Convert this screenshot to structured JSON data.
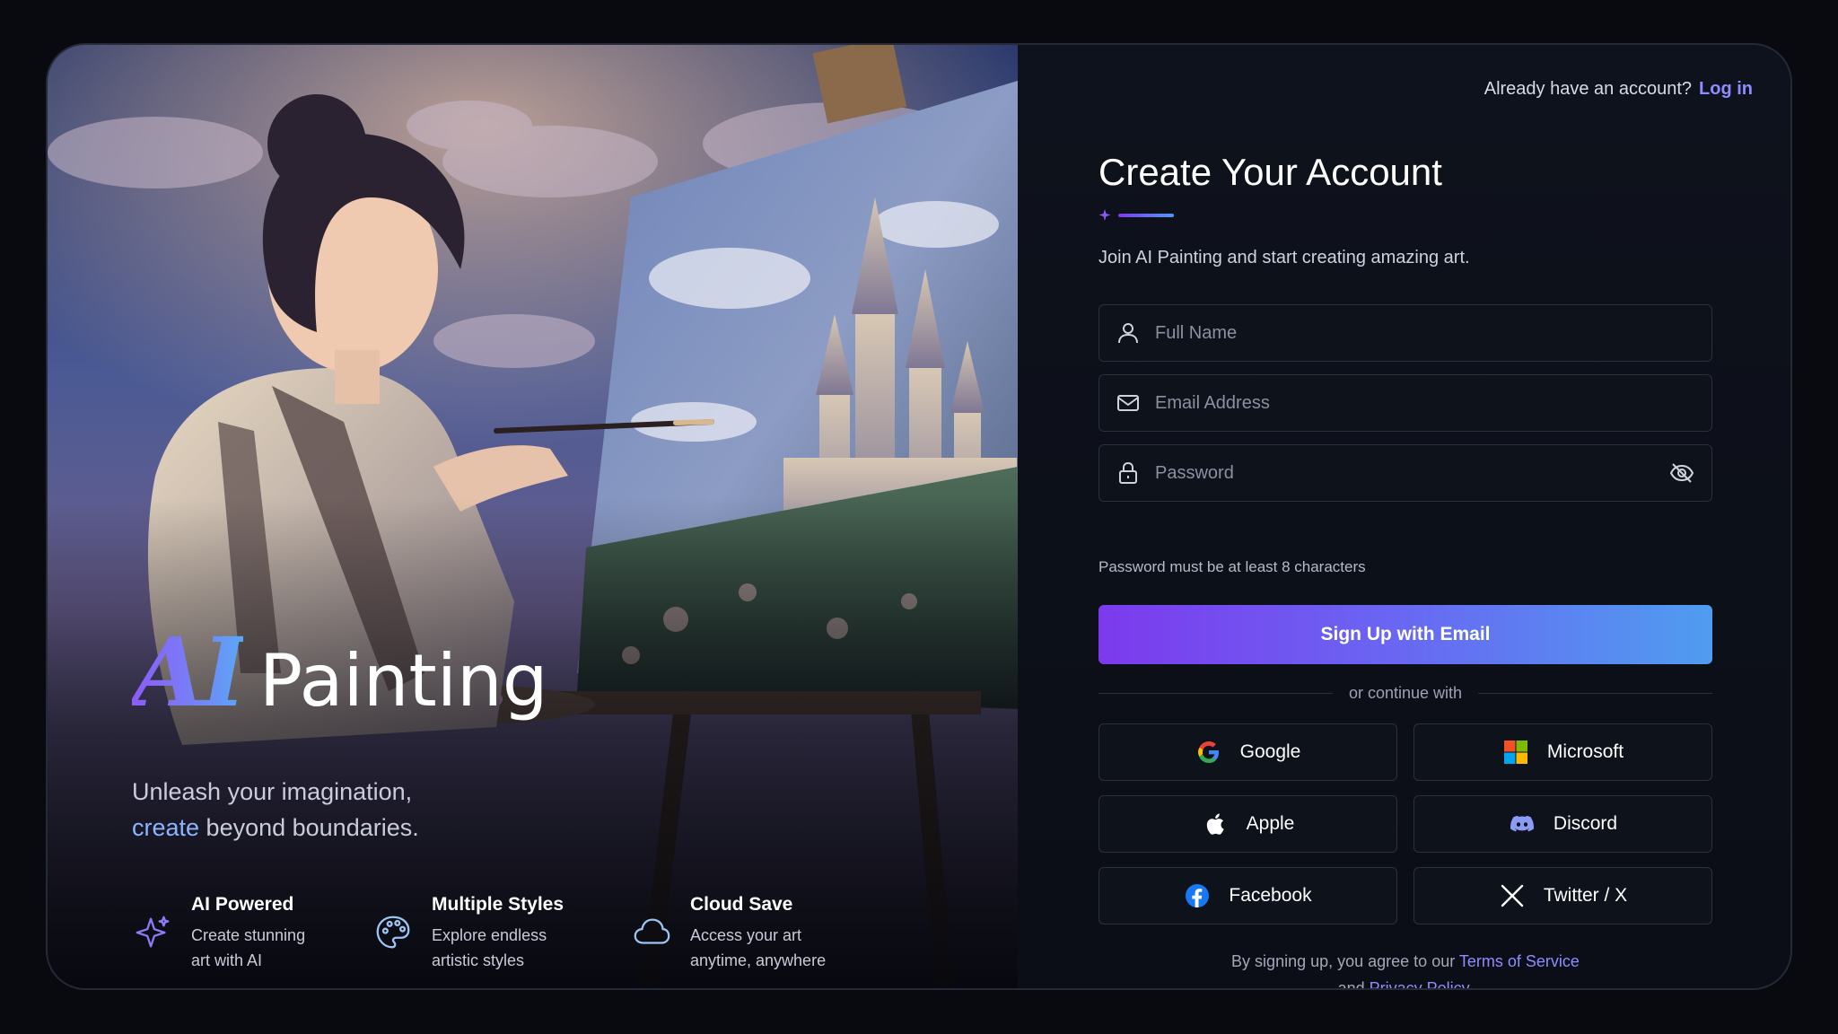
{
  "hero": {
    "brand_ai": "AI",
    "brand_word": "Painting",
    "tagline_line1": "Unleash your imagination,",
    "tagline_accent": "create",
    "tagline_rest": " beyond boundaries.",
    "features": [
      {
        "icon": "sparkle-icon",
        "title": "AI Powered",
        "line1": "Create stunning",
        "line2": "art with AI"
      },
      {
        "icon": "palette-icon",
        "title": "Multiple Styles",
        "line1": "Explore endless",
        "line2": "artistic styles"
      },
      {
        "icon": "cloud-icon",
        "title": "Cloud Save",
        "line1": "Access your art",
        "line2": "anytime, anywhere"
      }
    ]
  },
  "header": {
    "prompt": "Already have an account?",
    "login_label": "Log in"
  },
  "form": {
    "title": "Create Your Account",
    "subtitle": "Join AI Painting and start creating amazing art.",
    "full_name_placeholder": "Full Name",
    "email_placeholder": "Email Address",
    "password_placeholder": "Password",
    "password_hint": "Password must be at least 8 characters",
    "submit_label": "Sign Up with Email",
    "divider_label": "or continue with"
  },
  "social": [
    {
      "icon": "google-icon",
      "label": "Google"
    },
    {
      "icon": "microsoft-icon",
      "label": "Microsoft"
    },
    {
      "icon": "apple-icon",
      "label": "Apple"
    },
    {
      "icon": "discord-icon",
      "label": "Discord"
    },
    {
      "icon": "facebook-icon",
      "label": "Facebook"
    },
    {
      "icon": "x-icon",
      "label": "Twitter / X"
    }
  ],
  "legal": {
    "prefix": "By signing up, you agree to our ",
    "terms_label": "Terms of Service",
    "middle": "and ",
    "privacy_label": "Privacy Policy",
    "suffix": "."
  },
  "colors": {
    "accent": "#8f8cff",
    "gradient_start": "#7c3aed",
    "gradient_end": "#4f9df0",
    "panel_bg": "#0c1019"
  }
}
